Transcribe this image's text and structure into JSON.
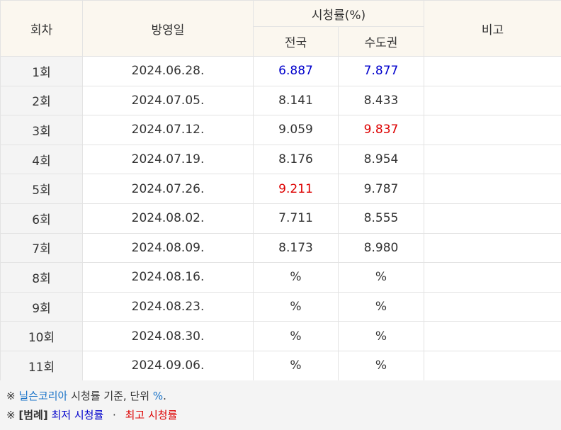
{
  "table": {
    "headers": {
      "episode": "회차",
      "airdate": "방영일",
      "ratings": "시청률(%)",
      "national": "전국",
      "capital": "수도권",
      "remarks": "비고"
    },
    "rows": [
      {
        "episode": "1회",
        "airdate": "2024.06.28.",
        "national": "6.887",
        "capital": "7.877",
        "remarks": "",
        "national_mark": "low",
        "capital_mark": "low"
      },
      {
        "episode": "2회",
        "airdate": "2024.07.05.",
        "national": "8.141",
        "capital": "8.433",
        "remarks": "",
        "national_mark": "",
        "capital_mark": ""
      },
      {
        "episode": "3회",
        "airdate": "2024.07.12.",
        "national": "9.059",
        "capital": "9.837",
        "remarks": "",
        "national_mark": "",
        "capital_mark": "high"
      },
      {
        "episode": "4회",
        "airdate": "2024.07.19.",
        "national": "8.176",
        "capital": "8.954",
        "remarks": "",
        "national_mark": "",
        "capital_mark": ""
      },
      {
        "episode": "5회",
        "airdate": "2024.07.26.",
        "national": "9.211",
        "capital": "9.787",
        "remarks": "",
        "national_mark": "high",
        "capital_mark": ""
      },
      {
        "episode": "6회",
        "airdate": "2024.08.02.",
        "national": "7.711",
        "capital": "8.555",
        "remarks": "",
        "national_mark": "",
        "capital_mark": ""
      },
      {
        "episode": "7회",
        "airdate": "2024.08.09.",
        "national": "8.173",
        "capital": "8.980",
        "remarks": "",
        "national_mark": "",
        "capital_mark": ""
      },
      {
        "episode": "8회",
        "airdate": "2024.08.16.",
        "national": "%",
        "capital": "%",
        "remarks": "",
        "national_mark": "",
        "capital_mark": ""
      },
      {
        "episode": "9회",
        "airdate": "2024.08.23.",
        "national": "%",
        "capital": "%",
        "remarks": "",
        "national_mark": "",
        "capital_mark": ""
      },
      {
        "episode": "10회",
        "airdate": "2024.08.30.",
        "national": "%",
        "capital": "%",
        "remarks": "",
        "national_mark": "",
        "capital_mark": ""
      },
      {
        "episode": "11회",
        "airdate": "2024.09.06.",
        "national": "%",
        "capital": "%",
        "remarks": "",
        "national_mark": "",
        "capital_mark": ""
      }
    ]
  },
  "notes": {
    "line1": {
      "symbol": "※",
      "source_link": "닐슨코리아",
      "text_mid": "시청률 기준, 단위",
      "unit": "%",
      "text_end": "."
    },
    "line2": {
      "symbol": "※",
      "legend_label": "[범례]",
      "lowest": "최저 시청률",
      "separator": "·",
      "highest": "최고 시청률"
    }
  },
  "colors": {
    "lowest": "#0000cc",
    "highest": "#dd0000",
    "link": "#1a73c8",
    "header_bg": "#fbf7ef",
    "episode_bg": "#f4f4f4"
  }
}
